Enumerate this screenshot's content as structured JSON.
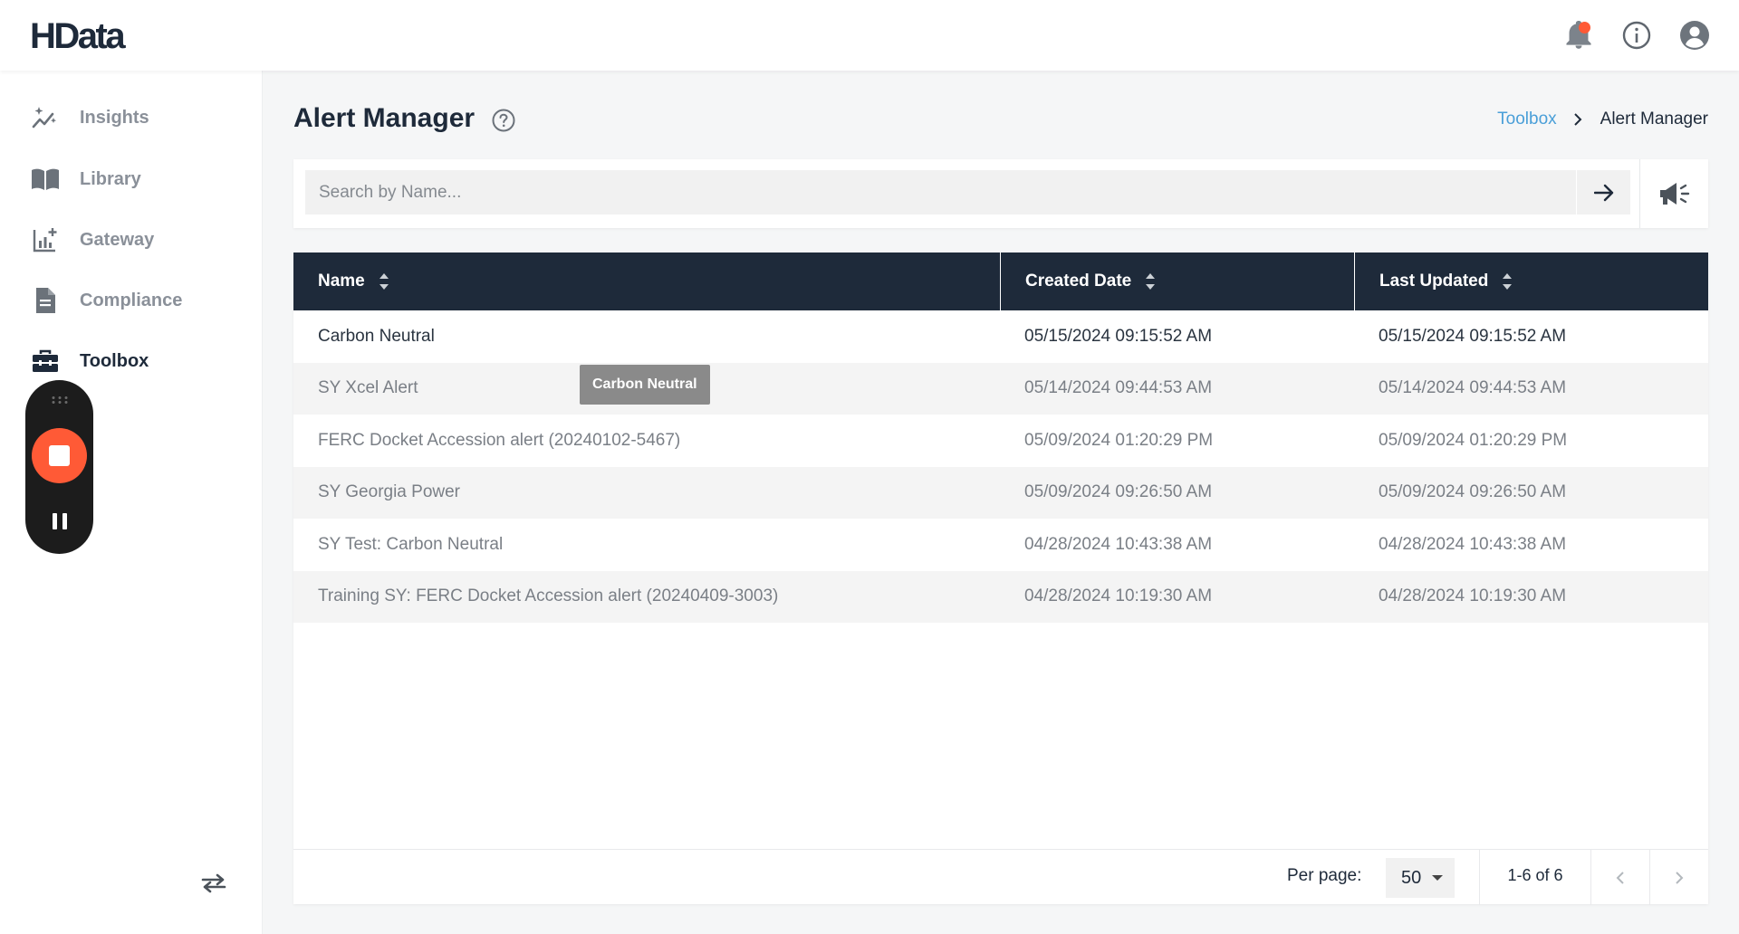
{
  "app": {
    "logo": "HData"
  },
  "header": {
    "notification_has_badge": true
  },
  "sidebar": {
    "items": [
      {
        "label": "Insights",
        "icon": "sparkles-icon",
        "active": false
      },
      {
        "label": "Library",
        "icon": "book-icon",
        "active": false
      },
      {
        "label": "Gateway",
        "icon": "chart-plus-icon",
        "active": false
      },
      {
        "label": "Compliance",
        "icon": "document-icon",
        "active": false
      },
      {
        "label": "Toolbox",
        "icon": "toolbox-icon",
        "active": true
      }
    ]
  },
  "page": {
    "title": "Alert Manager"
  },
  "breadcrumb": {
    "parent": "Toolbox",
    "current": "Alert Manager"
  },
  "search": {
    "placeholder": "Search by Name...",
    "value": ""
  },
  "table": {
    "columns": [
      "Name",
      "Created Date",
      "Last Updated"
    ],
    "rows": [
      {
        "name": "Carbon Neutral",
        "created": "05/15/2024 09:15:52 AM",
        "updated": "05/15/2024 09:15:52 AM"
      },
      {
        "name": "SY Xcel Alert",
        "created": "05/14/2024 09:44:53 AM",
        "updated": "05/14/2024 09:44:53 AM"
      },
      {
        "name": "FERC Docket Accession alert (20240102-5467)",
        "created": "05/09/2024 01:20:29 PM",
        "updated": "05/09/2024 01:20:29 PM"
      },
      {
        "name": "SY Georgia Power",
        "created": "05/09/2024 09:26:50 AM",
        "updated": "05/09/2024 09:26:50 AM"
      },
      {
        "name": "SY Test: Carbon Neutral",
        "created": "04/28/2024 10:43:38 AM",
        "updated": "04/28/2024 10:43:38 AM"
      },
      {
        "name": "Training SY: FERC Docket Accession alert (20240409-3003)",
        "created": "04/28/2024 10:19:30 AM",
        "updated": "04/28/2024 10:19:30 AM"
      }
    ]
  },
  "tooltip": {
    "text": "Carbon Neutral"
  },
  "pagination": {
    "per_page_label": "Per page:",
    "per_page_value": "50",
    "range": "1-6 of 6"
  },
  "colors": {
    "header_dark": "#1e2a3a",
    "accent_link": "#4a9fd8",
    "record_red": "#ff5a36"
  }
}
